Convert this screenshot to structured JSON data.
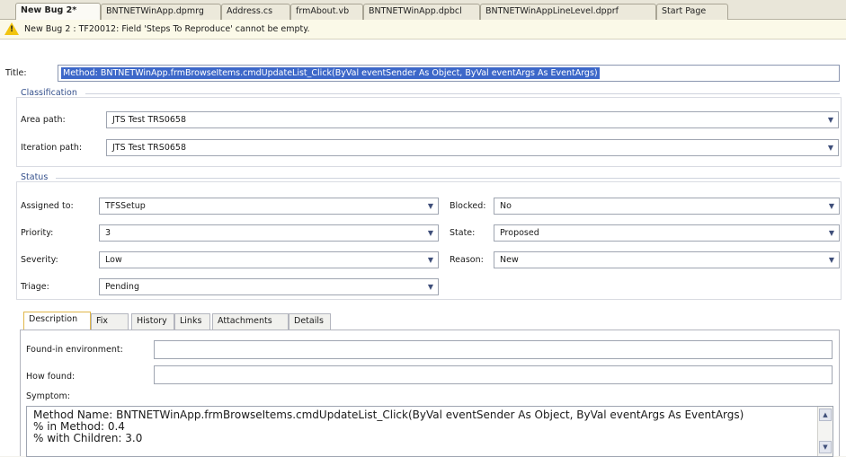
{
  "tabs": [
    {
      "label": "New Bug 2*",
      "active": true
    },
    {
      "label": "BNTNETWinApp.dpmrg",
      "active": false
    },
    {
      "label": "Address.cs",
      "active": false
    },
    {
      "label": "frmAbout.vb",
      "active": false
    },
    {
      "label": "BNTNETWinApp.dpbcl",
      "active": false
    },
    {
      "label": "BNTNETWinAppLineLevel.dpprf",
      "active": false
    },
    {
      "label": "Start Page",
      "active": false
    }
  ],
  "error_bar": {
    "icon": "warning-icon",
    "message": "New Bug 2 : TF20012: Field 'Steps To Reproduce' cannot be empty."
  },
  "form": {
    "title_label": "Title:",
    "title_value": "Method: BNTNETWinApp.frmBrowseItems.cmdUpdateList_Click(ByVal eventSender As Object, ByVal eventArgs As EventArgs)",
    "classification": {
      "heading": "Classification",
      "area_path_label": "Area path:",
      "area_path_value": "JTS Test TRS0658",
      "iteration_path_label": "Iteration path:",
      "iteration_path_value": "JTS Test TRS0658"
    },
    "status": {
      "heading": "Status",
      "assigned_to_label": "Assigned to:",
      "assigned_to_value": "TFSSetup",
      "priority_label": "Priority:",
      "priority_value": "3",
      "severity_label": "Severity:",
      "severity_value": "Low",
      "triage_label": "Triage:",
      "triage_value": "Pending",
      "blocked_label": "Blocked:",
      "blocked_value": "No",
      "state_label": "State:",
      "state_value": "Proposed",
      "reason_label": "Reason:",
      "reason_value": "New"
    }
  },
  "detail_tabs": [
    {
      "label": "Description",
      "active": true
    },
    {
      "label": "Fix",
      "active": false
    },
    {
      "label": "History",
      "active": false
    },
    {
      "label": "Links",
      "active": false
    },
    {
      "label": "Attachments",
      "active": false
    },
    {
      "label": "Details",
      "active": false
    }
  ],
  "description": {
    "found_in_label": "Found-in environment:",
    "found_in_value": "",
    "how_found_label": "How found:",
    "how_found_value": "",
    "symptom_label": "Symptom:",
    "symptom_lines": [
      "Method Name: BNTNETWinApp.frmBrowseItems.cmdUpdateList_Click(ByVal eventSender As Object, ByVal eventArgs As EventArgs)",
      "% in Method: 0.4",
      "% with Children: 3.0"
    ]
  },
  "colors": {
    "selection": "#3d68c9",
    "section_heading": "#34508c",
    "warning": "#f1c40f"
  }
}
